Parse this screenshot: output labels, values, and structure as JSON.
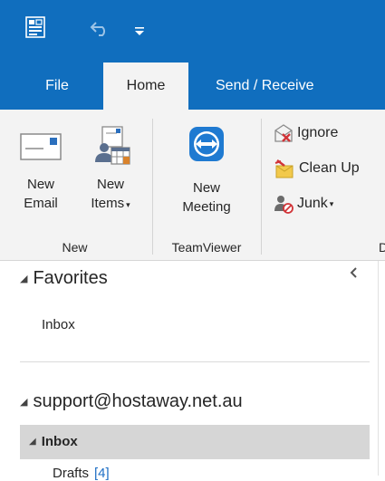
{
  "ribbon_tabs": [
    {
      "label": "File"
    },
    {
      "label": "Home"
    },
    {
      "label": "Send / Receive"
    }
  ],
  "groups": {
    "new": {
      "label": "New",
      "new_email": {
        "line1": "New",
        "line2": "Email"
      },
      "new_items": {
        "line1": "New",
        "line2": "Items"
      }
    },
    "teamviewer": {
      "label": "TeamViewer",
      "new_meeting": {
        "line1": "New",
        "line2": "Meeting"
      }
    },
    "delete": {
      "ignore": "Ignore",
      "clean_up": "Clean Up",
      "junk": "Junk"
    }
  },
  "folder_pane": {
    "favorites_label": "Favorites",
    "favorites_items": [
      "Inbox"
    ],
    "account_label": "support@hostaway.net.au",
    "inbox_label": "Inbox",
    "drafts_label": "Drafts",
    "drafts_count": "[4]"
  },
  "colors": {
    "title_bar": "#106ebe",
    "ribbon": "#f3f3f3",
    "selected_folder": "#d6d6d6",
    "unread_count": "#1f6fc5"
  },
  "icons": [
    "grid-app-icon",
    "undo-icon",
    "customize-qat-icon",
    "new-email-icon",
    "new-items-icon",
    "teamviewer-icon",
    "ignore-icon",
    "clean-up-icon",
    "junk-icon",
    "collapse-pane-icon"
  ]
}
